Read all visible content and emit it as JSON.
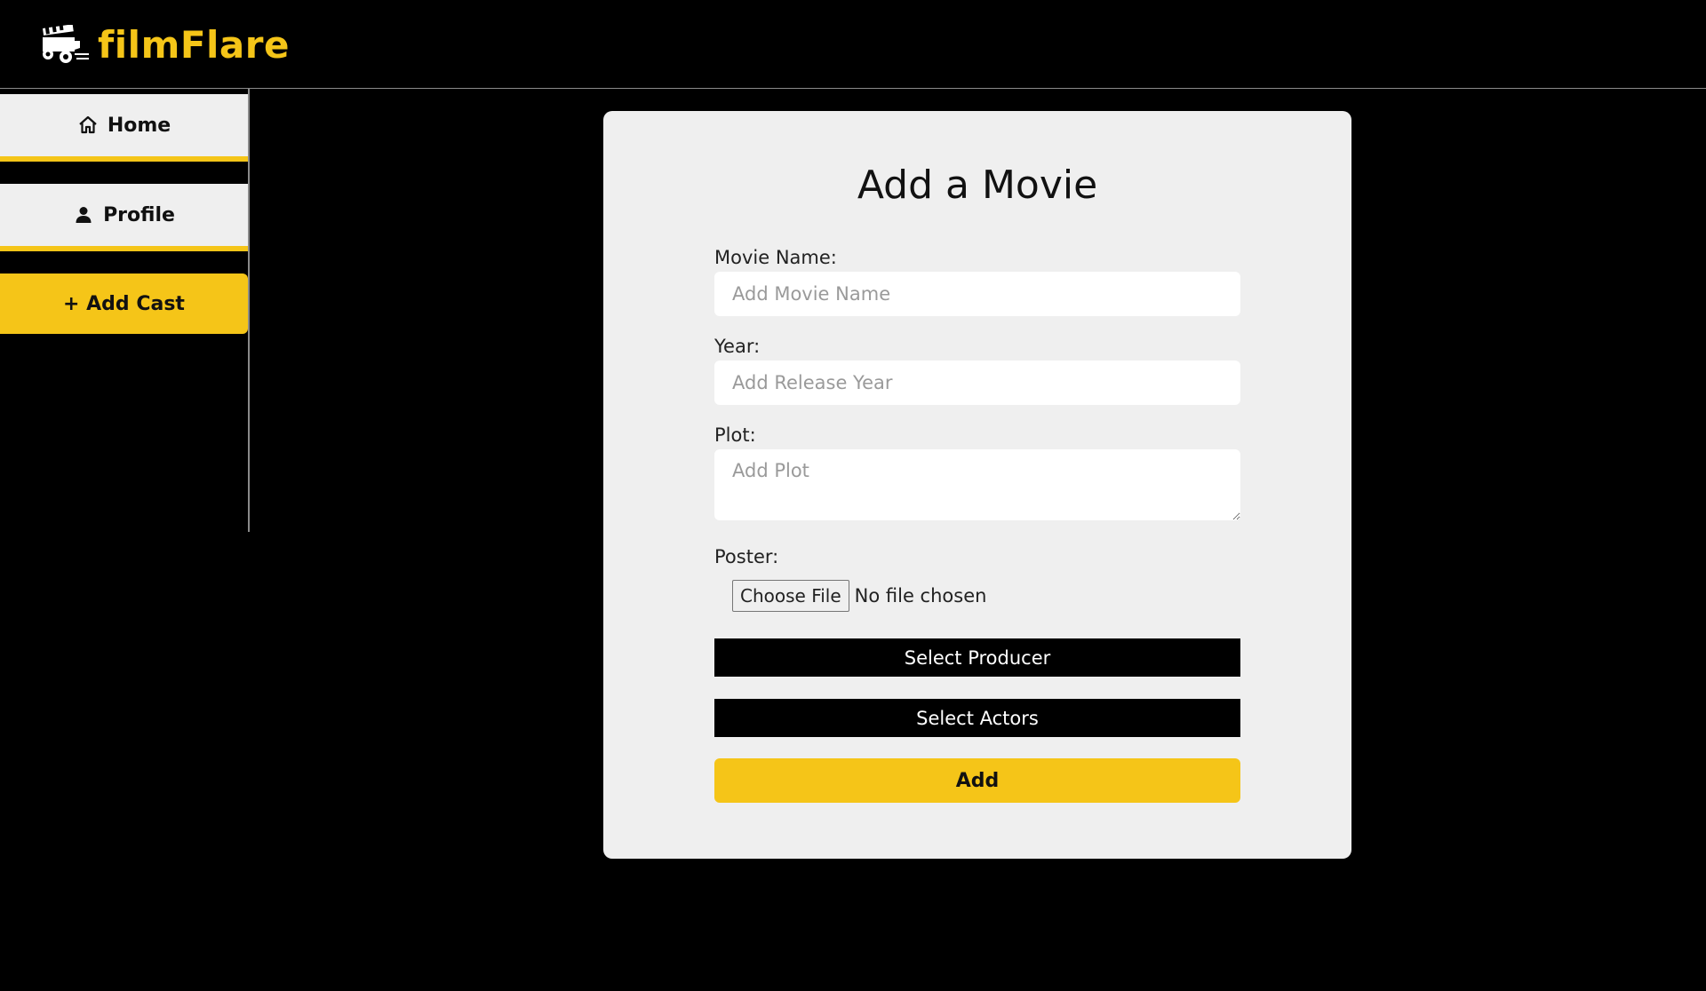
{
  "app": {
    "brand": "filmFlare",
    "accent_color": "#f5c518",
    "logo_icon": "movie-cart-icon"
  },
  "sidebar": {
    "items": [
      {
        "label": "Home",
        "icon": "home-icon"
      },
      {
        "label": "Profile",
        "icon": "user-icon"
      },
      {
        "label": "+ Add Cast",
        "icon": "plus-icon"
      }
    ]
  },
  "form": {
    "title": "Add a Movie",
    "movie_name": {
      "label": "Movie Name:",
      "placeholder": "Add Movie Name",
      "value": ""
    },
    "year": {
      "label": "Year:",
      "placeholder": "Add Release Year",
      "value": ""
    },
    "plot": {
      "label": "Plot:",
      "placeholder": "Add Plot",
      "value": ""
    },
    "poster": {
      "label": "Poster:",
      "button": "Choose File",
      "status": "No file chosen"
    },
    "select_producer": "Select Producer",
    "select_actors": "Select Actors",
    "submit": "Add"
  }
}
